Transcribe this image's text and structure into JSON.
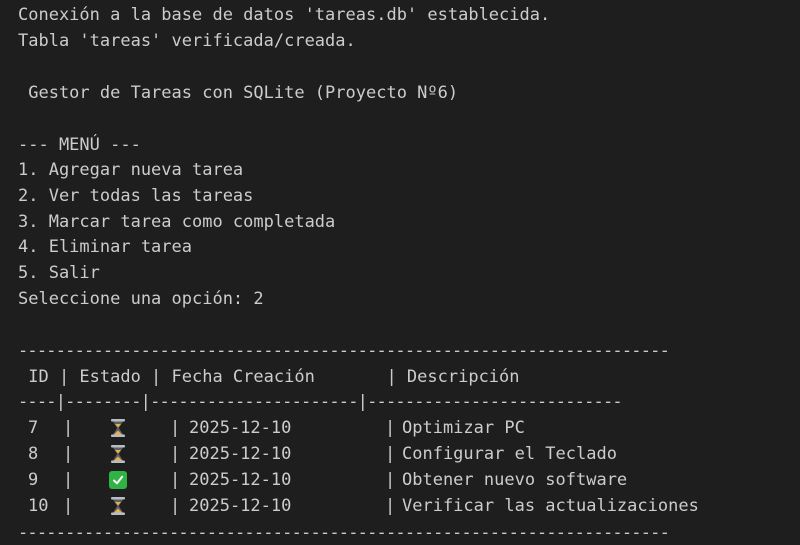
{
  "log": {
    "line1": "Conexión a la base de datos 'tareas.db' establecida.",
    "line2": "Tabla 'tareas' verificada/creada."
  },
  "app_title": " Gestor de Tareas con SQLite (Proyecto Nº6)",
  "menu": {
    "header": "--- MENÚ ---",
    "items": [
      "1. Agregar nueva tarea",
      "2. Ver todas las tareas",
      "3. Marcar tarea como completada",
      "4. Eliminar tarea",
      "5. Salir"
    ],
    "prompt": "Seleccione una opción: 2"
  },
  "table": {
    "border_line": "---------------------------------------------------------------------",
    "header_row": " ID | Estado | Fecha Creación       | Descripción",
    "separator_row": "----|--------|----------------------|---------------------------",
    "rows": [
      {
        "id": "7",
        "status_icon": "hourglass-icon",
        "date": "2025-12-10",
        "description": "Optimizar PC"
      },
      {
        "id": "8",
        "status_icon": "hourglass-icon",
        "date": "2025-12-10",
        "description": "Configurar el Teclado"
      },
      {
        "id": "9",
        "status_icon": "check-mark-icon",
        "date": "2025-12-10",
        "description": "Obtener nuevo software"
      },
      {
        "id": "10",
        "status_icon": "hourglass-icon",
        "date": "2025-12-10",
        "description": "Verificar las actualizaciones"
      }
    ],
    "pipe": "|"
  },
  "colors": {
    "background": "#1e1e1e",
    "text": "#cccccc",
    "check_green": "#2fb344",
    "hourglass_frame": "#b8bcc4",
    "hourglass_sand": "#e8b04a"
  }
}
